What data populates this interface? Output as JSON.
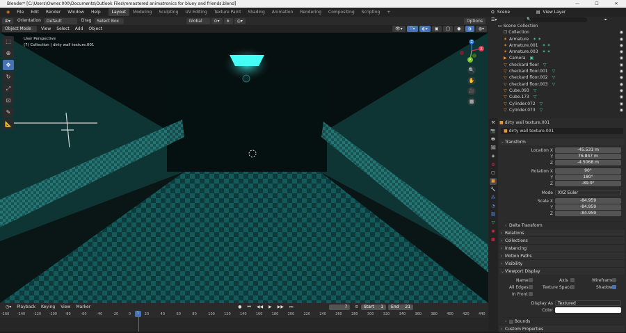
{
  "window": {
    "title": "Blender* [C:\\Users\\Owner.000\\Documents\\Outlook Files\\remastered animatronics for bluey and friends.blend]"
  },
  "menubar": {
    "items": [
      "File",
      "Edit",
      "Render",
      "Window",
      "Help"
    ],
    "workspaces": [
      "Layout",
      "Modeling",
      "Sculpting",
      "UV Editing",
      "Texture Paint",
      "Shading",
      "Animation",
      "Rendering",
      "Compositing",
      "Scripting"
    ],
    "add_tab": "+",
    "scene_label": "Scene",
    "view_layer_label": "View Layer"
  },
  "tool_header": {
    "orientation_label": "Orientation",
    "orientation_value": "Default",
    "drag_label": "Drag",
    "drag_value": "Select Box",
    "transform_orientation": "Global",
    "options": "Options"
  },
  "viewport_header": {
    "mode": "Object Mode",
    "menus": [
      "View",
      "Select",
      "Add",
      "Object"
    ]
  },
  "viewport": {
    "perspective": "User Perspective",
    "collection_info": "(7) Collection | dirty wall texture.001"
  },
  "gizmo": {
    "x": "X",
    "y": "Y",
    "z": "Z"
  },
  "timeline": {
    "menus": [
      "Playback",
      "Keying",
      "View",
      "Marker"
    ],
    "current_frame": "7",
    "start_label": "Start",
    "start": "1",
    "end_label": "End",
    "end": "21",
    "ticks": [
      "-160",
      "-140",
      "-120",
      "-100",
      "-80",
      "-60",
      "-40",
      "-20",
      "0",
      "20",
      "40",
      "60",
      "80",
      "100",
      "120",
      "140",
      "160",
      "180",
      "200",
      "220",
      "240",
      "260",
      "280",
      "300",
      "320",
      "340",
      "360",
      "380",
      "400",
      "420",
      "440"
    ],
    "playhead": "7"
  },
  "outliner": {
    "root": "Scene Collection",
    "collection": "Collection",
    "items": [
      {
        "name": "Armature",
        "icon": "armature-icon"
      },
      {
        "name": "Armature.001",
        "icon": "armature-icon"
      },
      {
        "name": "Armature.003",
        "icon": "armature-icon"
      },
      {
        "name": "Camera",
        "icon": "camera-icon"
      },
      {
        "name": "checkard floor",
        "icon": "mesh-icon"
      },
      {
        "name": "checkard floor.001",
        "icon": "mesh-icon"
      },
      {
        "name": "checkard floor.002",
        "icon": "mesh-icon"
      },
      {
        "name": "checkard floor.003",
        "icon": "mesh-icon"
      },
      {
        "name": "Cube.093",
        "icon": "mesh-icon"
      },
      {
        "name": "Cube.173",
        "icon": "mesh-icon"
      },
      {
        "name": "Cylinder.072",
        "icon": "mesh-icon"
      },
      {
        "name": "Cylinder.073",
        "icon": "mesh-icon"
      }
    ]
  },
  "properties": {
    "object_name": "dirty wall texture.001",
    "object_field": "dirty wall texture.001",
    "transform_header": "Transform",
    "location": {
      "label": "Location X",
      "x": "-45.531 m",
      "y": "76.847 m",
      "z": "-4.5068 m"
    },
    "rotation": {
      "label": "Rotation X",
      "x": "90°",
      "y": "180°",
      "z": "-89.9°"
    },
    "mode_label": "Mode",
    "mode_value": "XYZ Euler",
    "scale": {
      "label": "Scale X",
      "x": "-84.959",
      "y": "-84.959",
      "z": "-84.959"
    },
    "axis_y": "Y",
    "axis_z": "Z",
    "delta_transform": "Delta Transform",
    "panels": [
      "Relations",
      "Collections",
      "Instancing",
      "Motion Paths",
      "Visibility"
    ],
    "viewport_display": {
      "header": "Viewport Display",
      "name": "Name",
      "axis": "Axis",
      "wireframe": "Wireframe",
      "all_edges": "All Edges",
      "texture_space": "Texture Space",
      "shadow": "Shadow",
      "in_front": "In Front",
      "display_as_label": "Display As",
      "display_as": "Textured",
      "color_label": "Color",
      "bounds": "Bounds"
    },
    "custom_properties": "Custom Properties"
  }
}
